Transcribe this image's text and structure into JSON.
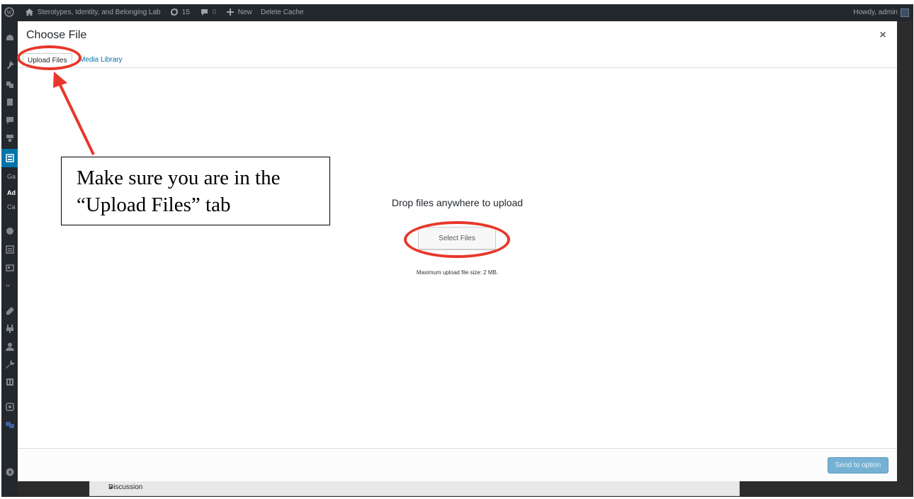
{
  "admin_bar": {
    "site_name": "Sterotypes, Identity, and Belonging Lab",
    "updates_count": "15",
    "comments_count": "0",
    "new_label": "New",
    "delete_cache_label": "Delete Cache",
    "howdy": "Howdy, admin"
  },
  "sidebar": {
    "partial_labels": [
      "Ga",
      "Ad",
      "Ca"
    ]
  },
  "modal": {
    "title": "Choose File",
    "close_label": "×",
    "tabs": [
      {
        "label": "Upload Files",
        "active": true
      },
      {
        "label": "Media Library",
        "active": false
      }
    ],
    "drop_text": "Drop files anywhere to upload",
    "select_button": "Select Files",
    "max_size": "Maximum upload file size: 2 MB.",
    "send_button": "Send to option"
  },
  "background_page": {
    "discussion_label": "Discussion",
    "caret": "▲"
  },
  "annotation": {
    "callout_line1": "Make sure you are in the",
    "callout_line2": "“Upload Files” tab",
    "color": "#e8372a"
  },
  "colors": {
    "admin_bar": "#23282d",
    "link": "#0073aa",
    "primary_button": "#75b1d3"
  }
}
